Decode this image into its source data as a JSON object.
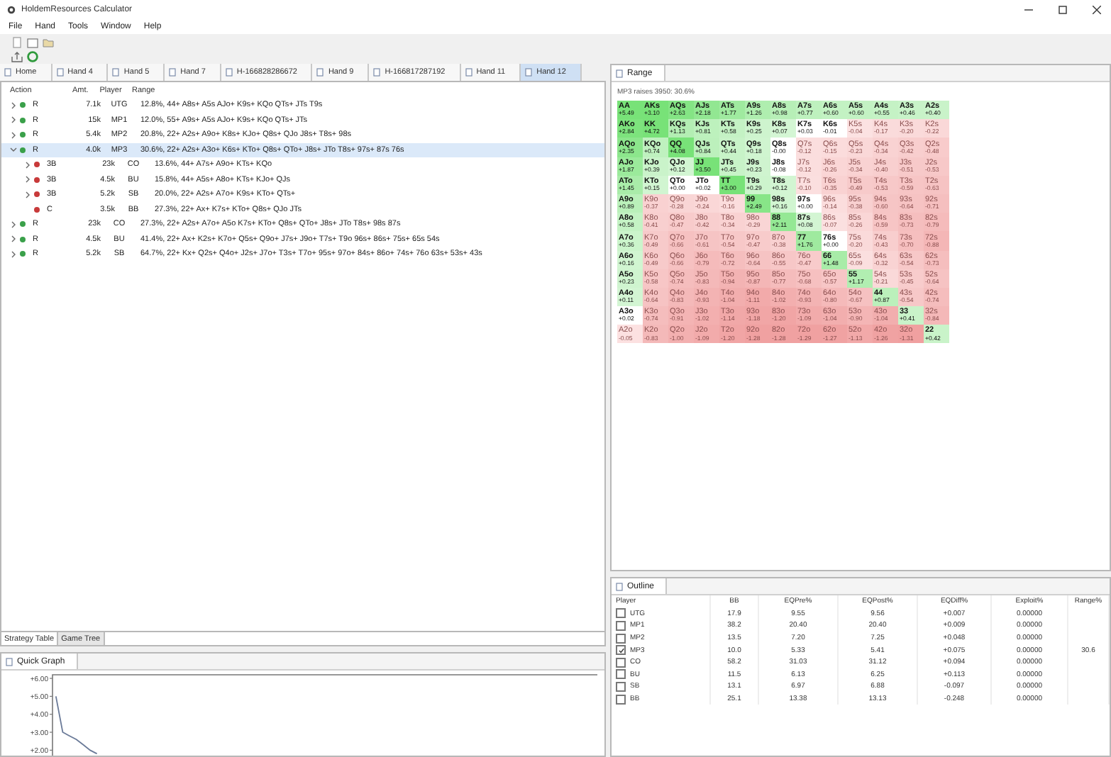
{
  "window": {
    "title": "HoldemResources Calculator"
  },
  "menu": [
    "File",
    "Hand",
    "Tools",
    "Window",
    "Help"
  ],
  "tabs": [
    {
      "label": "Home",
      "selected": false
    },
    {
      "label": "Hand 4",
      "selected": false
    },
    {
      "label": "Hand 5",
      "selected": false
    },
    {
      "label": "Hand 7",
      "selected": false
    },
    {
      "label": "H-166828286672",
      "selected": false
    },
    {
      "label": "Hand 9",
      "selected": false
    },
    {
      "label": "H-166817287192",
      "selected": false
    },
    {
      "label": "Hand 11",
      "selected": false
    },
    {
      "label": "Hand 12",
      "selected": true
    }
  ],
  "tree": {
    "columns": [
      "Action",
      "Amt.",
      "Player",
      "Range"
    ],
    "rows": [
      {
        "action": "R",
        "amount": "7.1k",
        "player": "UTG",
        "range": "12.8%, 44+ A8s+ A5s AJo+ K9s+ KQo QTs+ JTs T9s",
        "color": "#3aa04a",
        "expanded": false,
        "selected": false
      },
      {
        "action": "R",
        "amount": "15k",
        "player": "MP1",
        "range": "12.0%, 55+ A9s+ A5s AJo+ K9s+ KQo QTs+ JTs",
        "color": "#3aa04a",
        "expanded": false,
        "selected": false
      },
      {
        "action": "R",
        "amount": "5.4k",
        "player": "MP2",
        "range": "20.8%, 22+ A2s+ A9o+ K8s+ KJo+ Q8s+ QJo J8s+ T8s+ 98s",
        "color": "#3aa04a",
        "expanded": false,
        "selected": false
      },
      {
        "action": "R",
        "amount": "4.0k",
        "player": "MP3",
        "range": "30.6%, 22+ A2s+ A3o+ K6s+ KTo+ Q8s+ QTo+ J8s+ JTo T8s+ 97s+ 87s 76s",
        "color": "#3aa04a",
        "expanded": true,
        "selected": true,
        "children": [
          {
            "action": "3B",
            "amount": "23k",
            "player": "CO",
            "range": "13.6%, 44+ A7s+ A9o+ KTs+ KQo",
            "color": "#c83a3a",
            "expanded": false,
            "selected": false
          },
          {
            "action": "3B",
            "amount": "4.5k",
            "player": "BU",
            "range": "15.8%, 44+ A5s+ A8o+ KTs+ KJo+ QJs",
            "color": "#c83a3a",
            "expanded": false,
            "selected": false
          },
          {
            "action": "3B",
            "amount": "5.2k",
            "player": "SB",
            "range": "20.0%, 22+ A2s+ A7o+ K9s+ KTo+ QTs+",
            "color": "#c83a3a",
            "expanded": false,
            "selected": false
          },
          {
            "action": "C",
            "amount": "3.5k",
            "player": "BB",
            "range": "27.3%, 22+ Ax+ K7s+ KTo+ Q8s+ QJo JTs",
            "color": "#c83a3a",
            "selected": false
          }
        ]
      },
      {
        "action": "R",
        "amount": "23k",
        "player": "CO",
        "range": "27.3%, 22+ A2s+ A7o+ A5o K7s+ KTo+ Q8s+ QTo+ J8s+ JTo T8s+ 98s 87s",
        "color": "#3aa04a",
        "expanded": false,
        "selected": false
      },
      {
        "action": "R",
        "amount": "4.5k",
        "player": "BU",
        "range": "41.4%, 22+ Ax+ K2s+ K7o+ Q5s+ Q9o+ J7s+ J9o+ T7s+ T9o 96s+ 86s+ 75s+ 65s 54s",
        "color": "#3aa04a",
        "expanded": false,
        "selected": false
      },
      {
        "action": "R",
        "amount": "5.2k",
        "player": "SB",
        "range": "64.7%, 22+ Kx+ Q2s+ Q4o+ J2s+ J7o+ T3s+ T7o+ 95s+ 97o+ 84s+ 86o+ 74s+ 76o 63s+ 53s+ 43s",
        "color": "#3aa04a",
        "expanded": false,
        "selected": false
      }
    ]
  },
  "bottom_tabs": [
    {
      "label": "Strategy Table",
      "selected": true
    },
    {
      "label": "Game Tree",
      "selected": false
    }
  ],
  "quick_graph": {
    "title": "Quick Graph",
    "chart_data": {
      "type": "line",
      "categories": [
        null,
        null,
        null,
        null,
        null,
        null,
        null,
        null,
        null,
        null,
        null,
        null,
        null,
        null,
        null,
        null,
        null,
        null,
        null,
        null,
        null,
        null,
        null,
        null,
        null,
        null,
        null,
        null,
        null,
        null,
        null,
        null,
        null,
        null,
        null,
        null,
        null,
        null,
        null,
        null,
        null,
        null,
        null,
        null,
        null,
        null,
        null,
        null,
        null,
        null,
        null,
        null,
        null,
        null,
        null,
        null,
        null,
        null,
        null,
        null,
        null,
        null,
        null,
        null,
        null,
        null,
        null,
        null,
        null,
        null,
        null,
        null,
        null,
        null,
        null,
        null,
        null,
        null,
        null,
        null
      ],
      "ylim": [
        1.7,
        6.2
      ],
      "yticks": [
        {
          "value": 6,
          "label": "+6.00"
        },
        {
          "value": 5,
          "label": "+5.00"
        },
        {
          "value": 4,
          "label": "+4.00"
        },
        {
          "value": 3,
          "label": "+3.00"
        },
        {
          "value": 2,
          "label": "+2.00"
        }
      ],
      "series": [
        {
          "color": "#6a7a98",
          "values": [
            5.0,
            3.0,
            2.8,
            2.6,
            2.3,
            2.0,
            1.8,
            null,
            null,
            null,
            null,
            null,
            null,
            null,
            null,
            null,
            null,
            null,
            null,
            null,
            null,
            null,
            null,
            null,
            null,
            null,
            null,
            null,
            null,
            null,
            null,
            null,
            null,
            null,
            null,
            null,
            null,
            null,
            null,
            null,
            null,
            null,
            null,
            null,
            null,
            null,
            null,
            null,
            null,
            null,
            null,
            null,
            null,
            null,
            null,
            null,
            null,
            null,
            null,
            null,
            null,
            null,
            null,
            null,
            null,
            null,
            null,
            null,
            null,
            null,
            null,
            null,
            null,
            null,
            null,
            null,
            null,
            null,
            null,
            null
          ]
        }
      ]
    }
  },
  "range": {
    "title": "Range",
    "subtitle": "MP3 raises 3950: 30.6%",
    "rows": [
      [
        {
          "hand": "AA",
          "ev": "+5.49",
          "in_range": true
        },
        {
          "hand": "AKs",
          "ev": "+3.10",
          "in_range": true
        },
        {
          "hand": "AQs",
          "ev": "+2.63",
          "in_range": true
        },
        {
          "hand": "AJs",
          "ev": "+2.18",
          "in_range": true
        },
        {
          "hand": "ATs",
          "ev": "+1.77",
          "in_range": true
        },
        {
          "hand": "A9s",
          "ev": "+1.26",
          "in_range": true
        },
        {
          "hand": "A8s",
          "ev": "+0.98",
          "in_range": true
        },
        {
          "hand": "A7s",
          "ev": "+0.77",
          "in_range": true
        },
        {
          "hand": "A6s",
          "ev": "+0.60",
          "in_range": true
        },
        {
          "hand": "A5s",
          "ev": "+0.60",
          "in_range": true
        },
        {
          "hand": "A4s",
          "ev": "+0.55",
          "in_range": true
        },
        {
          "hand": "A3s",
          "ev": "+0.46",
          "in_range": true
        },
        {
          "hand": "A2s",
          "ev": "+0.40",
          "in_range": true
        }
      ],
      [
        {
          "hand": "AKo",
          "ev": "+2.84",
          "in_range": true
        },
        {
          "hand": "KK",
          "ev": "+4.72",
          "in_range": true
        },
        {
          "hand": "KQs",
          "ev": "+1.13",
          "in_range": true
        },
        {
          "hand": "KJs",
          "ev": "+0.81",
          "in_range": true
        },
        {
          "hand": "KTs",
          "ev": "+0.58",
          "in_range": true
        },
        {
          "hand": "K9s",
          "ev": "+0.25",
          "in_range": true
        },
        {
          "hand": "K8s",
          "ev": "+0.07",
          "in_range": true
        },
        {
          "hand": "K7s",
          "ev": "+0.03",
          "in_range": true
        },
        {
          "hand": "K6s",
          "ev": "-0.01",
          "in_range": true
        },
        {
          "hand": "K5s",
          "ev": "-0.04",
          "in_range": false
        },
        {
          "hand": "K4s",
          "ev": "-0.17",
          "in_range": false
        },
        {
          "hand": "K3s",
          "ev": "-0.20",
          "in_range": false
        },
        {
          "hand": "K2s",
          "ev": "-0.22",
          "in_range": false
        }
      ],
      [
        {
          "hand": "AQo",
          "ev": "+2.35",
          "in_range": true
        },
        {
          "hand": "KQo",
          "ev": "+0.74",
          "in_range": true
        },
        {
          "hand": "QQ",
          "ev": "+4.08",
          "in_range": true
        },
        {
          "hand": "QJs",
          "ev": "+0.84",
          "in_range": true
        },
        {
          "hand": "QTs",
          "ev": "+0.44",
          "in_range": true
        },
        {
          "hand": "Q9s",
          "ev": "+0.18",
          "in_range": true
        },
        {
          "hand": "Q8s",
          "ev": "-0.00",
          "in_range": true
        },
        {
          "hand": "Q7s",
          "ev": "-0.12",
          "in_range": false
        },
        {
          "hand": "Q6s",
          "ev": "-0.15",
          "in_range": false
        },
        {
          "hand": "Q5s",
          "ev": "-0.23",
          "in_range": false
        },
        {
          "hand": "Q4s",
          "ev": "-0.34",
          "in_range": false
        },
        {
          "hand": "Q3s",
          "ev": "-0.42",
          "in_range": false
        },
        {
          "hand": "Q2s",
          "ev": "-0.48",
          "in_range": false
        }
      ],
      [
        {
          "hand": "AJo",
          "ev": "+1.87",
          "in_range": true
        },
        {
          "hand": "KJo",
          "ev": "+0.39",
          "in_range": true
        },
        {
          "hand": "QJo",
          "ev": "+0.12",
          "in_range": true
        },
        {
          "hand": "JJ",
          "ev": "+3.50",
          "in_range": true
        },
        {
          "hand": "JTs",
          "ev": "+0.45",
          "in_range": true
        },
        {
          "hand": "J9s",
          "ev": "+0.23",
          "in_range": true
        },
        {
          "hand": "J8s",
          "ev": "-0.08",
          "in_range": true
        },
        {
          "hand": "J7s",
          "ev": "-0.12",
          "in_range": false
        },
        {
          "hand": "J6s",
          "ev": "-0.26",
          "in_range": false
        },
        {
          "hand": "J5s",
          "ev": "-0.34",
          "in_range": false
        },
        {
          "hand": "J4s",
          "ev": "-0.40",
          "in_range": false
        },
        {
          "hand": "J3s",
          "ev": "-0.51",
          "in_range": false
        },
        {
          "hand": "J2s",
          "ev": "-0.53",
          "in_range": false
        }
      ],
      [
        {
          "hand": "ATo",
          "ev": "+1.45",
          "in_range": true
        },
        {
          "hand": "KTo",
          "ev": "+0.15",
          "in_range": true
        },
        {
          "hand": "QTo",
          "ev": "+0.00",
          "in_range": true
        },
        {
          "hand": "JTo",
          "ev": "+0.02",
          "in_range": true
        },
        {
          "hand": "TT",
          "ev": "+3.00",
          "in_range": true
        },
        {
          "hand": "T9s",
          "ev": "+0.29",
          "in_range": true
        },
        {
          "hand": "T8s",
          "ev": "+0.12",
          "in_range": true
        },
        {
          "hand": "T7s",
          "ev": "-0.10",
          "in_range": false
        },
        {
          "hand": "T6s",
          "ev": "-0.35",
          "in_range": false
        },
        {
          "hand": "T5s",
          "ev": "-0.49",
          "in_range": false
        },
        {
          "hand": "T4s",
          "ev": "-0.53",
          "in_range": false
        },
        {
          "hand": "T3s",
          "ev": "-0.59",
          "in_range": false
        },
        {
          "hand": "T2s",
          "ev": "-0.63",
          "in_range": false
        }
      ],
      [
        {
          "hand": "A9o",
          "ev": "+0.89",
          "in_range": true
        },
        {
          "hand": "K9o",
          "ev": "-0.37",
          "in_range": false
        },
        {
          "hand": "Q9o",
          "ev": "-0.28",
          "in_range": false
        },
        {
          "hand": "J9o",
          "ev": "-0.24",
          "in_range": false
        },
        {
          "hand": "T9o",
          "ev": "-0.16",
          "in_range": false
        },
        {
          "hand": "99",
          "ev": "+2.49",
          "in_range": true
        },
        {
          "hand": "98s",
          "ev": "+0.16",
          "in_range": true
        },
        {
          "hand": "97s",
          "ev": "+0.00",
          "in_range": true
        },
        {
          "hand": "96s",
          "ev": "-0.14",
          "in_range": false
        },
        {
          "hand": "95s",
          "ev": "-0.38",
          "in_range": false
        },
        {
          "hand": "94s",
          "ev": "-0.60",
          "in_range": false
        },
        {
          "hand": "93s",
          "ev": "-0.64",
          "in_range": false
        },
        {
          "hand": "92s",
          "ev": "-0.71",
          "in_range": false
        }
      ],
      [
        {
          "hand": "A8o",
          "ev": "+0.58",
          "in_range": true
        },
        {
          "hand": "K8o",
          "ev": "-0.41",
          "in_range": false
        },
        {
          "hand": "Q8o",
          "ev": "-0.47",
          "in_range": false
        },
        {
          "hand": "J8o",
          "ev": "-0.42",
          "in_range": false
        },
        {
          "hand": "T8o",
          "ev": "-0.34",
          "in_range": false
        },
        {
          "hand": "98o",
          "ev": "-0.29",
          "in_range": false
        },
        {
          "hand": "88",
          "ev": "+2.11",
          "in_range": true
        },
        {
          "hand": "87s",
          "ev": "+0.08",
          "in_range": true
        },
        {
          "hand": "86s",
          "ev": "-0.07",
          "in_range": false
        },
        {
          "hand": "85s",
          "ev": "-0.26",
          "in_range": false
        },
        {
          "hand": "84s",
          "ev": "-0.59",
          "in_range": false
        },
        {
          "hand": "83s",
          "ev": "-0.73",
          "in_range": false
        },
        {
          "hand": "82s",
          "ev": "-0.79",
          "in_range": false
        }
      ],
      [
        {
          "hand": "A7o",
          "ev": "+0.36",
          "in_range": true
        },
        {
          "hand": "K7o",
          "ev": "-0.49",
          "in_range": false
        },
        {
          "hand": "Q7o",
          "ev": "-0.66",
          "in_range": false
        },
        {
          "hand": "J7o",
          "ev": "-0.61",
          "in_range": false
        },
        {
          "hand": "T7o",
          "ev": "-0.54",
          "in_range": false
        },
        {
          "hand": "97o",
          "ev": "-0.47",
          "in_range": false
        },
        {
          "hand": "87o",
          "ev": "-0.38",
          "in_range": false
        },
        {
          "hand": "77",
          "ev": "+1.76",
          "in_range": true
        },
        {
          "hand": "76s",
          "ev": "+0.00",
          "in_range": true
        },
        {
          "hand": "75s",
          "ev": "-0.20",
          "in_range": false
        },
        {
          "hand": "74s",
          "ev": "-0.43",
          "in_range": false
        },
        {
          "hand": "73s",
          "ev": "-0.70",
          "in_range": false
        },
        {
          "hand": "72s",
          "ev": "-0.88",
          "in_range": false
        }
      ],
      [
        {
          "hand": "A6o",
          "ev": "+0.16",
          "in_range": true
        },
        {
          "hand": "K6o",
          "ev": "-0.49",
          "in_range": false
        },
        {
          "hand": "Q6o",
          "ev": "-0.66",
          "in_range": false
        },
        {
          "hand": "J6o",
          "ev": "-0.79",
          "in_range": false
        },
        {
          "hand": "T6o",
          "ev": "-0.72",
          "in_range": false
        },
        {
          "hand": "96o",
          "ev": "-0.64",
          "in_range": false
        },
        {
          "hand": "86o",
          "ev": "-0.55",
          "in_range": false
        },
        {
          "hand": "76o",
          "ev": "-0.47",
          "in_range": false
        },
        {
          "hand": "66",
          "ev": "+1.48",
          "in_range": true
        },
        {
          "hand": "65s",
          "ev": "-0.09",
          "in_range": false
        },
        {
          "hand": "64s",
          "ev": "-0.32",
          "in_range": false
        },
        {
          "hand": "63s",
          "ev": "-0.54",
          "in_range": false
        },
        {
          "hand": "62s",
          "ev": "-0.73",
          "in_range": false
        }
      ],
      [
        {
          "hand": "A5o",
          "ev": "+0.23",
          "in_range": true
        },
        {
          "hand": "K5o",
          "ev": "-0.58",
          "in_range": false
        },
        {
          "hand": "Q5o",
          "ev": "-0.74",
          "in_range": false
        },
        {
          "hand": "J5o",
          "ev": "-0.83",
          "in_range": false
        },
        {
          "hand": "T5o",
          "ev": "-0.94",
          "in_range": false
        },
        {
          "hand": "95o",
          "ev": "-0.87",
          "in_range": false
        },
        {
          "hand": "85o",
          "ev": "-0.77",
          "in_range": false
        },
        {
          "hand": "75o",
          "ev": "-0.68",
          "in_range": false
        },
        {
          "hand": "65o",
          "ev": "-0.57",
          "in_range": false
        },
        {
          "hand": "55",
          "ev": "+1.17",
          "in_range": true
        },
        {
          "hand": "54s",
          "ev": "-0.21",
          "in_range": false
        },
        {
          "hand": "53s",
          "ev": "-0.45",
          "in_range": false
        },
        {
          "hand": "52s",
          "ev": "-0.64",
          "in_range": false
        }
      ],
      [
        {
          "hand": "A4o",
          "ev": "+0.11",
          "in_range": true
        },
        {
          "hand": "K4o",
          "ev": "-0.64",
          "in_range": false
        },
        {
          "hand": "Q4o",
          "ev": "-0.83",
          "in_range": false
        },
        {
          "hand": "J4o",
          "ev": "-0.93",
          "in_range": false
        },
        {
          "hand": "T4o",
          "ev": "-1.04",
          "in_range": false
        },
        {
          "hand": "94o",
          "ev": "-1.11",
          "in_range": false
        },
        {
          "hand": "84o",
          "ev": "-1.02",
          "in_range": false
        },
        {
          "hand": "74o",
          "ev": "-0.93",
          "in_range": false
        },
        {
          "hand": "64o",
          "ev": "-0.80",
          "in_range": false
        },
        {
          "hand": "54o",
          "ev": "-0.67",
          "in_range": false
        },
        {
          "hand": "44",
          "ev": "+0.87",
          "in_range": true
        },
        {
          "hand": "43s",
          "ev": "-0.54",
          "in_range": false
        },
        {
          "hand": "42s",
          "ev": "-0.74",
          "in_range": false
        }
      ],
      [
        {
          "hand": "A3o",
          "ev": "+0.02",
          "in_range": true
        },
        {
          "hand": "K3o",
          "ev": "-0.74",
          "in_range": false
        },
        {
          "hand": "Q3o",
          "ev": "-0.91",
          "in_range": false
        },
        {
          "hand": "J3o",
          "ev": "-1.02",
          "in_range": false
        },
        {
          "hand": "T3o",
          "ev": "-1.14",
          "in_range": false
        },
        {
          "hand": "93o",
          "ev": "-1.18",
          "in_range": false
        },
        {
          "hand": "83o",
          "ev": "-1.20",
          "in_range": false
        },
        {
          "hand": "73o",
          "ev": "-1.09",
          "in_range": false
        },
        {
          "hand": "63o",
          "ev": "-1.04",
          "in_range": false
        },
        {
          "hand": "53o",
          "ev": "-0.90",
          "in_range": false
        },
        {
          "hand": "43o",
          "ev": "-1.04",
          "in_range": false
        },
        {
          "hand": "33",
          "ev": "+0.41",
          "in_range": true
        },
        {
          "hand": "32s",
          "ev": "-0.84",
          "in_range": false
        }
      ],
      [
        {
          "hand": "A2o",
          "ev": "-0.05",
          "in_range": false
        },
        {
          "hand": "K2o",
          "ev": "-0.83",
          "in_range": false
        },
        {
          "hand": "Q2o",
          "ev": "-1.00",
          "in_range": false
        },
        {
          "hand": "J2o",
          "ev": "-1.09",
          "in_range": false
        },
        {
          "hand": "T2o",
          "ev": "-1.20",
          "in_range": false
        },
        {
          "hand": "92o",
          "ev": "-1.28",
          "in_range": false
        },
        {
          "hand": "82o",
          "ev": "-1.28",
          "in_range": false
        },
        {
          "hand": "72o",
          "ev": "-1.29",
          "in_range": false
        },
        {
          "hand": "62o",
          "ev": "-1.27",
          "in_range": false
        },
        {
          "hand": "52o",
          "ev": "-1.13",
          "in_range": false
        },
        {
          "hand": "42o",
          "ev": "-1.26",
          "in_range": false
        },
        {
          "hand": "32o",
          "ev": "-1.31",
          "in_range": false
        },
        {
          "hand": "22",
          "ev": "+0.42",
          "in_range": true
        }
      ]
    ]
  },
  "outline": {
    "title": "Outline",
    "columns": [
      "Player",
      "BB",
      "EQPre%",
      "EQPost%",
      "EQDiff%",
      "Exploit%",
      "Range%"
    ],
    "rows": [
      {
        "player": "UTG",
        "checked": false,
        "bb": "17.9",
        "eq_pre": "9.55",
        "eq_post": "9.56",
        "eq_diff": "+0.007",
        "exploit": "0.00000"
      },
      {
        "player": "MP1",
        "checked": false,
        "bb": "38.2",
        "eq_pre": "20.40",
        "eq_post": "20.40",
        "eq_diff": "+0.009",
        "exploit": "0.00000"
      },
      {
        "player": "MP2",
        "checked": false,
        "bb": "13.5",
        "eq_pre": "7.20",
        "eq_post": "7.25",
        "eq_diff": "+0.048",
        "exploit": "0.00000"
      },
      {
        "player": "MP3",
        "checked": true,
        "bb": "10.0",
        "eq_pre": "5.33",
        "eq_post": "5.41",
        "eq_diff": "+0.075",
        "exploit": "0.00000",
        "range_pct": "30.6"
      },
      {
        "player": "CO",
        "checked": false,
        "bb": "58.2",
        "eq_pre": "31.03",
        "eq_post": "31.12",
        "eq_diff": "+0.094",
        "exploit": "0.00000"
      },
      {
        "player": "BU",
        "checked": false,
        "bb": "11.5",
        "eq_pre": "6.13",
        "eq_post": "6.25",
        "eq_diff": "+0.113",
        "exploit": "0.00000"
      },
      {
        "player": "SB",
        "checked": false,
        "bb": "13.1",
        "eq_pre": "6.97",
        "eq_post": "6.88",
        "eq_diff": "-0.097",
        "exploit": "0.00000"
      },
      {
        "player": "BB",
        "checked": false,
        "bb": "25.1",
        "eq_pre": "13.38",
        "eq_post": "13.13",
        "eq_diff": "-0.248",
        "exploit": "0.00000"
      }
    ]
  }
}
